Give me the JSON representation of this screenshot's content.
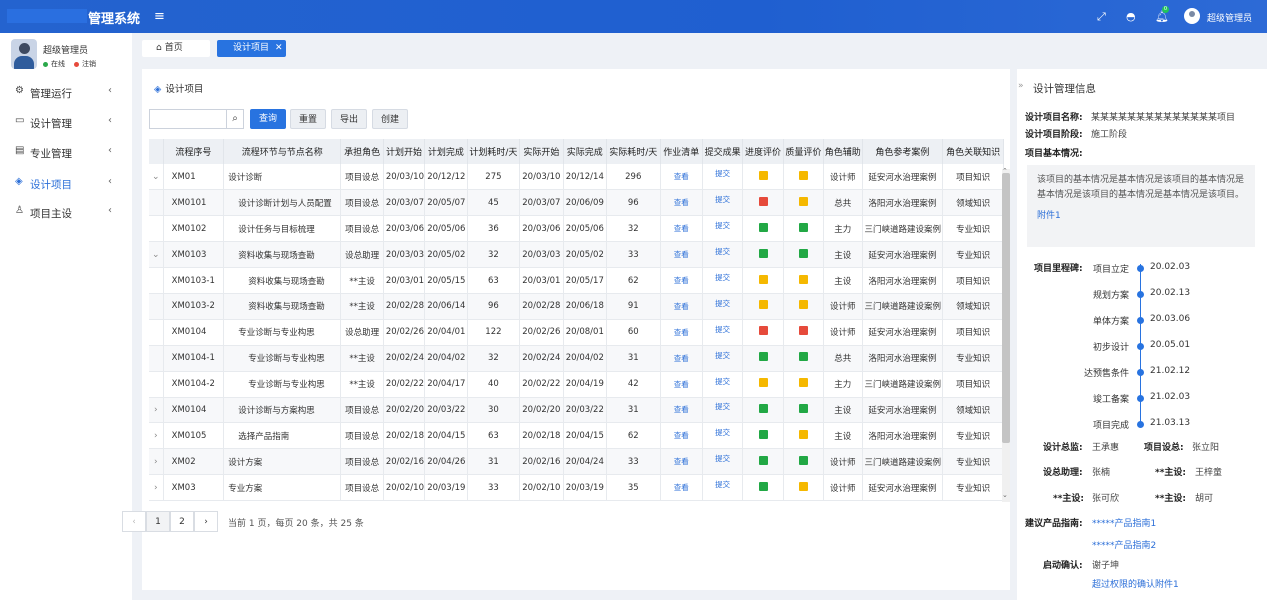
{
  "topbar": {
    "title": "管理系统",
    "notification_count": "0",
    "user": "超级管理员"
  },
  "sidebar": {
    "user_name": "超级管理员",
    "online_label": "在线",
    "logout_label": "注销",
    "items": [
      {
        "label": "管理运行",
        "icon": "gear-icon"
      },
      {
        "label": "设计管理",
        "icon": "monitor-icon"
      },
      {
        "label": "专业管理",
        "icon": "document-icon"
      },
      {
        "label": "设计项目",
        "icon": "layers-icon"
      },
      {
        "label": "项目主设",
        "icon": "user-icon"
      }
    ]
  },
  "tabs": [
    {
      "label": "首页"
    },
    {
      "label": "设计项目"
    }
  ],
  "panel": {
    "title": "设计项目",
    "search_placeholder": "",
    "buttons": {
      "query": "查询",
      "reset": "重置",
      "export": "导出",
      "create": "创建"
    }
  },
  "table": {
    "columns": [
      "流程序号",
      "流程环节与节点名称",
      "承担角色",
      "计划开始",
      "计划完成",
      "计划耗时/天",
      "实际开始",
      "实际完成",
      "实际耗时/天",
      "作业清单",
      "提交成果",
      "进度评价",
      "质量评价",
      "角色辅助",
      "角色参考案例",
      "角色关联知识"
    ],
    "rows": [
      {
        "exp": "⌄",
        "id": "XM01",
        "name": "设计诊断",
        "indent": 0,
        "role": "项目设总",
        "ps": "20/03/10",
        "pe": "20/12/12",
        "pd": "275",
        "as": "20/03/10",
        "ae": "20/12/14",
        "ad": "296",
        "list": "查看",
        "submit": "提交",
        "prog": "y",
        "qual": "y",
        "aux": "设计师",
        "case": "延安河水治理案例",
        "know": "项目知识"
      },
      {
        "exp": "",
        "id": "XM0101",
        "name": "设计诊断计划与人员配置",
        "indent": 1,
        "role": "项目设总",
        "ps": "20/03/07",
        "pe": "20/05/07",
        "pd": "45",
        "as": "20/03/07",
        "ae": "20/06/09",
        "ad": "96",
        "list": "查看",
        "submit": "提交",
        "prog": "r",
        "qual": "y",
        "aux": "总共",
        "case": "洛阳河水治理案例",
        "know": "领域知识"
      },
      {
        "exp": "",
        "id": "XM0102",
        "name": "设计任务与目标梳理",
        "indent": 1,
        "role": "项目设总",
        "ps": "20/03/06",
        "pe": "20/05/06",
        "pd": "36",
        "as": "20/03/06",
        "ae": "20/05/06",
        "ad": "32",
        "list": "查看",
        "submit": "提交",
        "prog": "g",
        "qual": "g",
        "aux": "主力",
        "case": "三门峡道路建设案例",
        "know": "专业知识"
      },
      {
        "exp": "⌄",
        "id": "XM0103",
        "name": "资料收集与现场查勘",
        "indent": 1,
        "role": "设总助理",
        "ps": "20/03/03",
        "pe": "20/05/02",
        "pd": "32",
        "as": "20/03/03",
        "ae": "20/05/02",
        "ad": "33",
        "list": "查看",
        "submit": "提交",
        "prog": "g",
        "qual": "g",
        "aux": "主设",
        "case": "延安河水治理案例",
        "know": "专业知识"
      },
      {
        "exp": "",
        "id": "XM0103-1",
        "name": "资料收集与现场查勘",
        "indent": 2,
        "role": "**主设",
        "ps": "20/03/01",
        "pe": "20/05/15",
        "pd": "63",
        "as": "20/03/01",
        "ae": "20/05/17",
        "ad": "62",
        "list": "查看",
        "submit": "提交",
        "prog": "y",
        "qual": "y",
        "aux": "主设",
        "case": "洛阳河水治理案例",
        "know": "项目知识"
      },
      {
        "exp": "",
        "id": "XM0103-2",
        "name": "资料收集与现场查勘",
        "indent": 2,
        "role": "**主设",
        "ps": "20/02/28",
        "pe": "20/06/14",
        "pd": "96",
        "as": "20/02/28",
        "ae": "20/06/18",
        "ad": "91",
        "list": "查看",
        "submit": "提交",
        "prog": "y",
        "qual": "y",
        "aux": "设计师",
        "case": "三门峡道路建设案例",
        "know": "领域知识"
      },
      {
        "exp": "",
        "id": "XM0104",
        "name": "专业诊断与专业构思",
        "indent": 1,
        "role": "设总助理",
        "ps": "20/02/26",
        "pe": "20/04/01",
        "pd": "122",
        "as": "20/02/26",
        "ae": "20/08/01",
        "ad": "60",
        "list": "查看",
        "submit": "提交",
        "prog": "r",
        "qual": "r",
        "aux": "设计师",
        "case": "延安河水治理案例",
        "know": "项目知识"
      },
      {
        "exp": "",
        "id": "XM0104-1",
        "name": "专业诊断与专业构思",
        "indent": 2,
        "role": "**主设",
        "ps": "20/02/24",
        "pe": "20/04/02",
        "pd": "32",
        "as": "20/02/24",
        "ae": "20/04/02",
        "ad": "31",
        "list": "查看",
        "submit": "提交",
        "prog": "g",
        "qual": "g",
        "aux": "总共",
        "case": "洛阳河水治理案例",
        "know": "专业知识"
      },
      {
        "exp": "",
        "id": "XM0104-2",
        "name": "专业诊断与专业构思",
        "indent": 2,
        "role": "**主设",
        "ps": "20/02/22",
        "pe": "20/04/17",
        "pd": "40",
        "as": "20/02/22",
        "ae": "20/04/19",
        "ad": "42",
        "list": "查看",
        "submit": "提交",
        "prog": "y",
        "qual": "y",
        "aux": "主力",
        "case": "三门峡道路建设案例",
        "know": "项目知识"
      },
      {
        "exp": "›",
        "id": "XM0104",
        "name": "设计诊断与方案构思",
        "indent": 1,
        "role": "项目设总",
        "ps": "20/02/20",
        "pe": "20/03/22",
        "pd": "30",
        "as": "20/02/20",
        "ae": "20/03/22",
        "ad": "31",
        "list": "查看",
        "submit": "提交",
        "prog": "g",
        "qual": "g",
        "aux": "主设",
        "case": "延安河水治理案例",
        "know": "领域知识"
      },
      {
        "exp": "›",
        "id": "XM0105",
        "name": "选择产品指南",
        "indent": 1,
        "role": "项目设总",
        "ps": "20/02/18",
        "pe": "20/04/15",
        "pd": "63",
        "as": "20/02/18",
        "ae": "20/04/15",
        "ad": "62",
        "list": "查看",
        "submit": "提交",
        "prog": "g",
        "qual": "y",
        "aux": "主设",
        "case": "洛阳河水治理案例",
        "know": "专业知识"
      },
      {
        "exp": "›",
        "id": "XM02",
        "name": "设计方案",
        "indent": 0,
        "role": "项目设总",
        "ps": "20/02/16",
        "pe": "20/04/26",
        "pd": "31",
        "as": "20/02/16",
        "ae": "20/04/24",
        "ad": "33",
        "list": "查看",
        "submit": "提交",
        "prog": "g",
        "qual": "g",
        "aux": "设计师",
        "case": "三门峡道路建设案例",
        "know": "专业知识"
      },
      {
        "exp": "›",
        "id": "XM03",
        "name": "专业方案",
        "indent": 0,
        "role": "项目设总",
        "ps": "20/02/10",
        "pe": "20/03/19",
        "pd": "33",
        "as": "20/02/10",
        "ae": "20/03/19",
        "ad": "35",
        "list": "查看",
        "submit": "提交",
        "prog": "g",
        "qual": "y",
        "aux": "设计师",
        "case": "延安河水治理案例",
        "know": "专业知识"
      }
    ]
  },
  "pagination": {
    "prev": "‹",
    "next": "›",
    "pages": [
      "1",
      "2"
    ],
    "info": "当前  1  页，每页  20  条，共 25 条"
  },
  "right": {
    "title": "设计管理信息",
    "name_label": "设计项目名称:",
    "name_value": "某某某某某某某某某某某某某某项目",
    "stage_label": "设计项目阶段:",
    "stage_value": "施工阶段",
    "basic_label": "项目基本情况:",
    "desc": "该项目的基本情况是基本情况是该项目的基本情况是基本情况是该项目的基本情况是基本情况是该项目。",
    "desc_attach": "附件1",
    "milestone_label": "项目里程碑:",
    "milestones": [
      {
        "label": "项目立定",
        "date": "20.02.03"
      },
      {
        "label": "规划方案",
        "date": "20.02.13"
      },
      {
        "label": "单体方案",
        "date": "20.03.06"
      },
      {
        "label": "初步设计",
        "date": "20.05.01"
      },
      {
        "label": "达预售条件",
        "date": "21.02.12"
      },
      {
        "label": "竣工备案",
        "date": "21.02.03"
      },
      {
        "label": "项目完成",
        "date": "21.03.13"
      }
    ],
    "people": [
      {
        "label": "设计总监:",
        "value": "王承惠"
      },
      {
        "label": "项目设总:",
        "value": "张立阳"
      },
      {
        "label": "设总助理:",
        "value": "张楠"
      },
      {
        "label": "**主设:",
        "value": "王梓童"
      },
      {
        "label": "**主设:",
        "value": "张可欣"
      },
      {
        "label": "**主设:",
        "value": "胡可"
      }
    ],
    "guide_label": "建议产品指南:",
    "guides": [
      "*****产品指南1",
      "*****产品指南2"
    ],
    "confirm_label": "启动确认:",
    "confirm_value": "谢子坤",
    "confirm_link": "超过权限的确认附件1"
  }
}
